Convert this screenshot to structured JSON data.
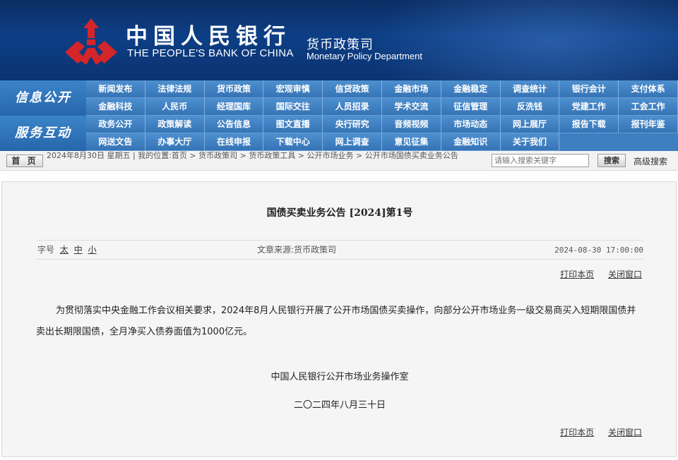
{
  "header": {
    "bank_name_cn": "中国人民银行",
    "bank_name_en": "THE PEOPLE'S BANK OF CHINA",
    "dept_cn": "货币政策司",
    "dept_en": "Monetary Policy Department",
    "emblem_color": "#d3252a"
  },
  "nav": {
    "sections": [
      {
        "label": "信息公开",
        "items": [
          "新闻发布",
          "法律法规",
          "货币政策",
          "宏观审慎",
          "信贷政策",
          "金融市场",
          "金融稳定",
          "调查统计",
          "银行会计",
          "支付体系",
          "金融科技",
          "人民币",
          "经理国库",
          "国际交往",
          "人员招录",
          "学术交流",
          "征信管理",
          "反洗钱",
          "党建工作",
          "工会工作"
        ]
      },
      {
        "label": "服务互动",
        "items": [
          "政务公开",
          "政策解读",
          "公告信息",
          "图文直播",
          "央行研究",
          "音频视频",
          "市场动态",
          "网上展厅",
          "报告下载",
          "报刊年鉴",
          "网送文告",
          "办事大厅",
          "在线申报",
          "下载中心",
          "网上调查",
          "意见征集",
          "金融知识",
          "关于我们"
        ]
      }
    ]
  },
  "crumbbar": {
    "home_label": "首 页",
    "date_text": "2024年8月30日 星期五",
    "location_text": "我的位置:首页 > 货币政策司 > 货币政策工具 > 公开市场业务 > 公开市场国债买卖业务公告",
    "search_placeholder": "请输入搜索关键字",
    "search_button": "搜索",
    "advanced_search": "高级搜索"
  },
  "article": {
    "title": "国债买卖业务公告 [2024]第1号",
    "font_size_label": "字号",
    "font_sizes": [
      "太",
      "中",
      "小"
    ],
    "source_text": "文章来源:货币政策司",
    "publish_time": "2024-08-30 17:00:00",
    "print_label": "打印本页",
    "close_label": "关闭窗口",
    "body": "为贯彻落实中央金融工作会议相关要求，2024年8月人民银行开展了公开市场国债买卖操作，向部分公开市场业务一级交易商买入短期限国债并卖出长期限国债，全月净买入债券面值为1000亿元。",
    "signature_org": "中国人民银行公开市场业务操作室",
    "signature_date": "二〇二四年八月三十日"
  }
}
